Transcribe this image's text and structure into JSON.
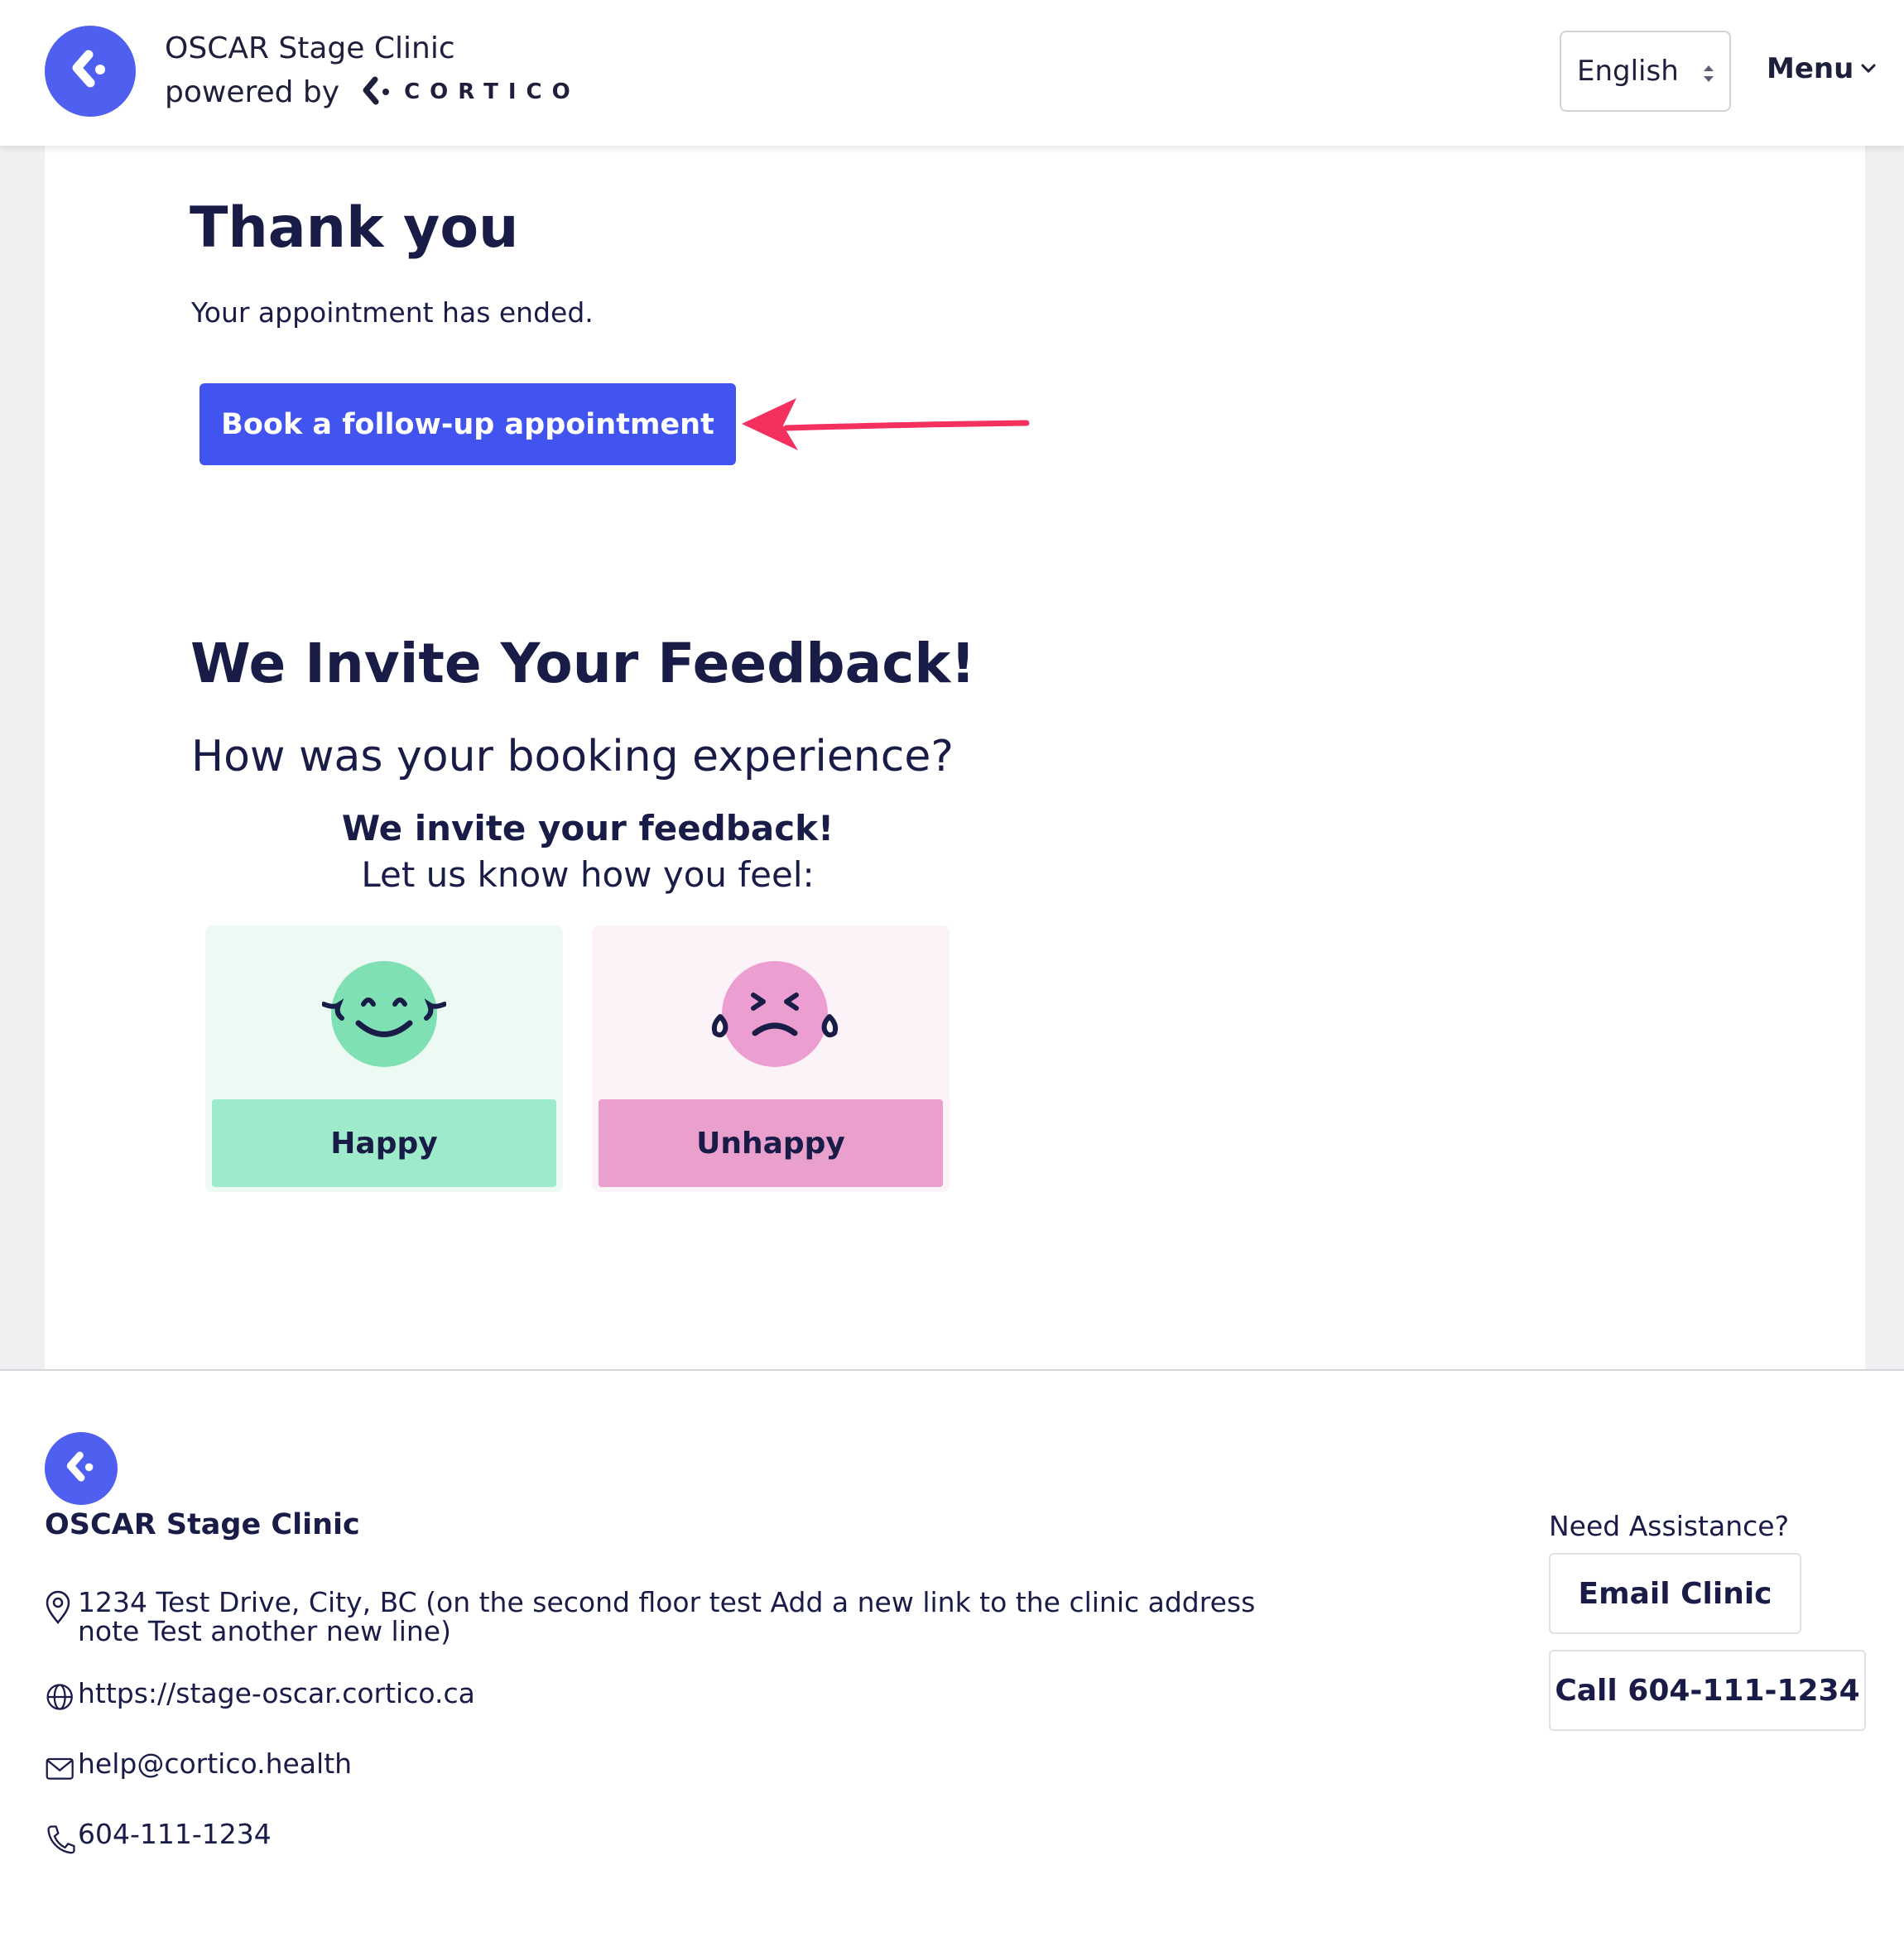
{
  "header": {
    "clinic_name": "OSCAR Stage Clinic",
    "powered_by": "powered by",
    "brand_word": "CORTICO",
    "language": "English",
    "menu_label": "Menu"
  },
  "main": {
    "title": "Thank you",
    "message": "Your appointment has ended.",
    "book_button": "Book a follow-up appointment",
    "feedback_title": "We Invite Your Feedback!",
    "feedback_question": "How was your booking experience?",
    "feedback_invite": "We invite your feedback!",
    "feedback_prompt": "Let us know how you feel:",
    "options": [
      {
        "label": "Happy",
        "icon": "happy-face-icon"
      },
      {
        "label": "Unhappy",
        "icon": "unhappy-face-icon"
      }
    ]
  },
  "footer": {
    "clinic_name": "OSCAR Stage Clinic",
    "address_line1": "1234 Test Drive, City, BC (on the second floor test Add a new link to the clinic address",
    "address_line2": "note Test another new line)",
    "website": "https://stage-oscar.cortico.ca",
    "email": "help@cortico.health",
    "phone": "604-111-1234",
    "need_assistance": "Need Assistance?",
    "email_button": "Email Clinic",
    "call_button": "Call 604-111-1234"
  },
  "colors": {
    "brand_blue": "#4254ef",
    "navy_text": "#181c47",
    "happy_green": "#9debca",
    "unhappy_pink": "#e9a0cc",
    "annotation_arrow": "#f4305f"
  }
}
